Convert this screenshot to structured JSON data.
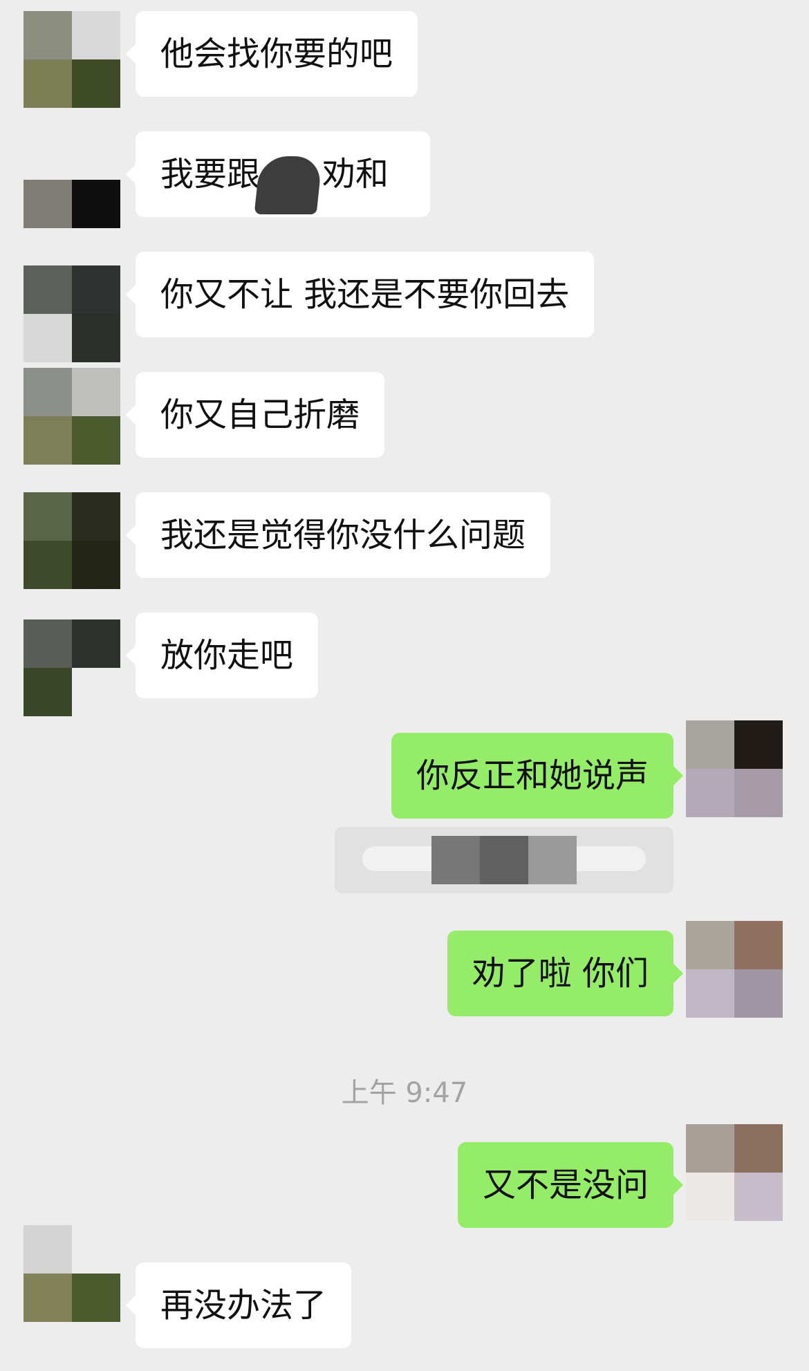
{
  "conversation": {
    "messages": [
      {
        "side": "in",
        "text": "他会找你要的吧"
      },
      {
        "side": "in",
        "text": "我要跟"
      },
      {
        "side": "in",
        "text": "你又不让 我还是不要你回去"
      },
      {
        "side": "in",
        "text": "你又自己折磨"
      },
      {
        "side": "in",
        "text": "我还是觉得你没什么问题"
      },
      {
        "side": "in",
        "text": "放你走吧"
      },
      {
        "side": "out",
        "text": "你反正和她说声"
      },
      {
        "side": "out",
        "text": "劝了啦 你们"
      },
      {
        "side": "out",
        "text": "又不是没问"
      },
      {
        "side": "in",
        "text": "再没办法了"
      }
    ],
    "message2_tail": "劝和",
    "timestamp": "上午 9:47"
  },
  "colors": {
    "background": "#ededed",
    "incoming_bubble": "#ffffff",
    "outgoing_bubble": "#95ec69",
    "timestamp_text": "#a3a3a3"
  }
}
